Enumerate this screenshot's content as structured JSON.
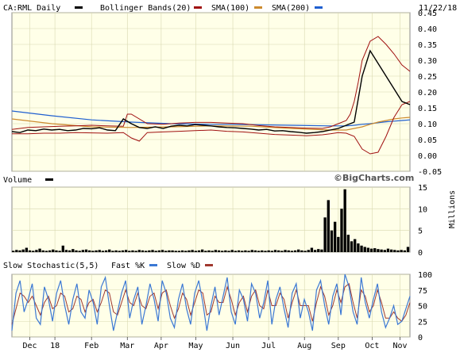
{
  "chart_data": [
    {
      "type": "line",
      "title": "CA:RML Daily",
      "date": "11/22/18",
      "legend": [
        {
          "label": "CA:RML Daily",
          "color": "#000000"
        },
        {
          "label": "Bollinger Bands(20)",
          "color": "#a01010"
        },
        {
          "label": "SMA(100)",
          "color": "#cc8a2e"
        },
        {
          "label": "SMA(200)",
          "color": "#1f5fd0"
        }
      ],
      "ylim": [
        -0.05,
        0.45
      ],
      "yticks": [
        "0.45",
        "0.40",
        "0.35",
        "0.30",
        "0.25",
        "0.20",
        "0.15",
        "0.10",
        "0.05",
        "0.00",
        "-0.05"
      ],
      "ytick_values": [
        0.45,
        0.4,
        0.35,
        0.3,
        0.25,
        0.2,
        0.15,
        0.1,
        0.05,
        0.0,
        -0.05
      ],
      "watermark": "©BigCharts.com",
      "price": {
        "x": [
          0,
          2,
          4,
          6,
          8,
          10,
          12,
          14,
          16,
          18,
          20,
          22,
          24,
          26,
          28,
          30,
          32,
          34,
          36,
          38,
          40,
          42,
          44,
          46,
          48,
          50,
          52,
          54,
          56,
          58,
          60,
          62,
          64,
          66,
          68,
          70,
          72,
          74,
          76,
          78,
          80,
          82,
          84,
          86,
          88,
          90,
          92,
          94,
          96,
          98,
          100
        ],
        "y": [
          0.075,
          0.072,
          0.08,
          0.078,
          0.083,
          0.08,
          0.082,
          0.078,
          0.08,
          0.085,
          0.084,
          0.087,
          0.08,
          0.078,
          0.115,
          0.1,
          0.088,
          0.085,
          0.09,
          0.085,
          0.092,
          0.095,
          0.093,
          0.097,
          0.095,
          0.093,
          0.09,
          0.088,
          0.087,
          0.085,
          0.083,
          0.08,
          0.082,
          0.077,
          0.078,
          0.075,
          0.073,
          0.07,
          0.072,
          0.075,
          0.08,
          0.085,
          0.095,
          0.105,
          0.25,
          0.33,
          0.29,
          0.25,
          0.21,
          0.17,
          0.16
        ]
      },
      "bollinger_upper": {
        "x": [
          0,
          4,
          8,
          12,
          16,
          20,
          24,
          28,
          29,
          30,
          34,
          38,
          42,
          46,
          50,
          54,
          58,
          62,
          66,
          70,
          74,
          78,
          80,
          82,
          84,
          85,
          86,
          87,
          88,
          90,
          92,
          94,
          96,
          98,
          100
        ],
        "y": [
          0.082,
          0.088,
          0.09,
          0.092,
          0.093,
          0.095,
          0.093,
          0.092,
          0.13,
          0.13,
          0.1,
          0.098,
          0.102,
          0.104,
          0.104,
          0.102,
          0.1,
          0.094,
          0.09,
          0.088,
          0.086,
          0.085,
          0.09,
          0.1,
          0.11,
          0.13,
          0.17,
          0.23,
          0.3,
          0.36,
          0.375,
          0.35,
          0.32,
          0.285,
          0.265
        ]
      },
      "bollinger_lower": {
        "x": [
          0,
          4,
          8,
          12,
          16,
          20,
          24,
          28,
          30,
          32,
          34,
          38,
          42,
          46,
          50,
          54,
          58,
          62,
          66,
          70,
          74,
          78,
          80,
          82,
          84,
          86,
          87,
          88,
          90,
          92,
          94,
          96,
          98,
          100
        ],
        "y": [
          0.068,
          0.068,
          0.07,
          0.07,
          0.072,
          0.071,
          0.07,
          0.072,
          0.055,
          0.045,
          0.072,
          0.074,
          0.076,
          0.078,
          0.08,
          0.076,
          0.074,
          0.07,
          0.066,
          0.064,
          0.062,
          0.065,
          0.068,
          0.072,
          0.07,
          0.06,
          0.04,
          0.02,
          0.005,
          0.01,
          0.06,
          0.12,
          0.16,
          0.17
        ]
      },
      "sma100": {
        "x": [
          0,
          10,
          20,
          30,
          40,
          50,
          60,
          70,
          80,
          84,
          86,
          88,
          90,
          92,
          94,
          96,
          98,
          100
        ],
        "y": [
          0.115,
          0.1,
          0.09,
          0.088,
          0.09,
          0.093,
          0.092,
          0.085,
          0.08,
          0.08,
          0.085,
          0.09,
          0.098,
          0.105,
          0.11,
          0.115,
          0.118,
          0.12
        ]
      },
      "sma200": {
        "x": [
          0,
          10,
          20,
          30,
          40,
          50,
          60,
          70,
          80,
          84,
          86,
          88,
          90,
          92,
          94,
          96,
          98,
          100
        ],
        "y": [
          0.14,
          0.125,
          0.112,
          0.105,
          0.1,
          0.098,
          0.097,
          0.095,
          0.093,
          0.093,
          0.095,
          0.098,
          0.1,
          0.103,
          0.106,
          0.108,
          0.11,
          0.112
        ]
      }
    },
    {
      "type": "bar",
      "title": "Volume",
      "ylabel": "Millions",
      "ylim": [
        0,
        15
      ],
      "yticks": [
        "15",
        "10",
        "5",
        "0"
      ],
      "ytick_values": [
        15,
        10,
        5,
        0
      ],
      "values": [
        0.3,
        0.5,
        0.4,
        0.6,
        1.0,
        0.4,
        0.3,
        0.5,
        0.8,
        0.4,
        0.3,
        0.4,
        0.6,
        0.4,
        0.3,
        1.5,
        0.5,
        0.4,
        0.7,
        0.4,
        0.3,
        0.5,
        0.6,
        0.4,
        0.3,
        0.4,
        0.5,
        0.3,
        0.4,
        0.6,
        0.3,
        0.4,
        0.3,
        0.4,
        0.5,
        0.3,
        0.4,
        0.3,
        0.5,
        0.4,
        0.3,
        0.4,
        0.5,
        0.3,
        0.4,
        0.5,
        0.3,
        0.4,
        0.4,
        0.3,
        0.3,
        0.4,
        0.3,
        0.4,
        0.5,
        0.3,
        0.4,
        0.6,
        0.3,
        0.4,
        0.3,
        0.5,
        0.4,
        0.3,
        0.4,
        0.3,
        0.5,
        0.3,
        0.4,
        0.3,
        0.4,
        0.3,
        0.5,
        0.4,
        0.3,
        0.4,
        0.3,
        0.4,
        0.3,
        0.5,
        0.4,
        0.3,
        0.5,
        0.4,
        0.3,
        0.4,
        0.6,
        0.4,
        0.3,
        0.5,
        1.0,
        0.5,
        0.7,
        0.6,
        8.0,
        12.0,
        5.0,
        7.0,
        3.5,
        10.0,
        14.5,
        4.0,
        2.5,
        3.0,
        2.0,
        1.5,
        1.2,
        1.0,
        0.8,
        0.9,
        0.7,
        0.6,
        0.5,
        0.8,
        0.6,
        0.5,
        0.4,
        0.5,
        0.4,
        1.2
      ]
    },
    {
      "type": "line",
      "title": "Slow Stochastic(5,5)",
      "legend": [
        {
          "label": "Fast %K",
          "color": "#3b78d4"
        },
        {
          "label": "Slow %D",
          "color": "#a0382f"
        }
      ],
      "ylim": [
        0,
        100
      ],
      "yticks": [
        "100",
        "75",
        "50",
        "25",
        "0"
      ],
      "ytick_values": [
        100,
        75,
        50,
        25,
        0
      ],
      "fast_k": [
        10,
        70,
        90,
        40,
        60,
        85,
        30,
        20,
        80,
        60,
        25,
        70,
        90,
        50,
        20,
        60,
        85,
        40,
        30,
        75,
        55,
        20,
        80,
        95,
        50,
        10,
        40,
        70,
        90,
        30,
        60,
        80,
        20,
        50,
        85,
        60,
        25,
        90,
        70,
        30,
        15,
        60,
        85,
        45,
        20,
        70,
        90,
        55,
        10,
        50,
        80,
        35,
        65,
        95,
        40,
        20,
        75,
        60,
        25,
        85,
        70,
        30,
        55,
        90,
        20,
        60,
        80,
        45,
        15,
        70,
        85,
        30,
        60,
        40,
        10,
        75,
        90,
        50,
        20,
        65,
        85,
        35,
        100,
        80,
        40,
        20,
        95,
        55,
        30,
        60,
        85,
        40,
        15,
        30,
        50,
        20,
        25,
        45,
        65
      ],
      "slow_d": [
        20,
        45,
        70,
        65,
        55,
        65,
        50,
        35,
        55,
        65,
        45,
        50,
        70,
        65,
        40,
        45,
        65,
        60,
        40,
        55,
        60,
        40,
        55,
        75,
        70,
        40,
        35,
        55,
        75,
        55,
        50,
        70,
        50,
        45,
        65,
        70,
        45,
        70,
        75,
        50,
        30,
        45,
        70,
        60,
        35,
        55,
        75,
        70,
        35,
        40,
        65,
        55,
        55,
        80,
        60,
        35,
        55,
        65,
        40,
        65,
        75,
        50,
        45,
        75,
        50,
        50,
        70,
        60,
        30,
        55,
        75,
        50,
        50,
        50,
        25,
        55,
        80,
        65,
        35,
        50,
        75,
        55,
        80,
        85,
        55,
        30,
        75,
        65,
        40,
        50,
        75,
        55,
        30,
        30,
        40,
        30,
        25,
        35,
        55
      ]
    }
  ],
  "x_axis": {
    "tick_labels": [
      "Dec",
      "18",
      "Feb",
      "Mar",
      "Apr",
      "May",
      "Jun",
      "Jul",
      "Aug",
      "Sep",
      "Oct",
      "Nov"
    ],
    "tick_fractions": [
      0.045,
      0.108,
      0.2,
      0.29,
      0.375,
      0.462,
      0.555,
      0.645,
      0.735,
      0.82,
      0.905,
      0.975
    ]
  },
  "colors": {
    "panel_background": "#ffffe8",
    "grid": "#d8d8b0",
    "price_bar": "#000000",
    "bollinger": "#a01010",
    "sma100": "#cc8a2e",
    "sma200": "#1f5fd0",
    "fast_k": "#3b78d4",
    "slow_d": "#a0382f",
    "divider": "#c8c8c8"
  }
}
